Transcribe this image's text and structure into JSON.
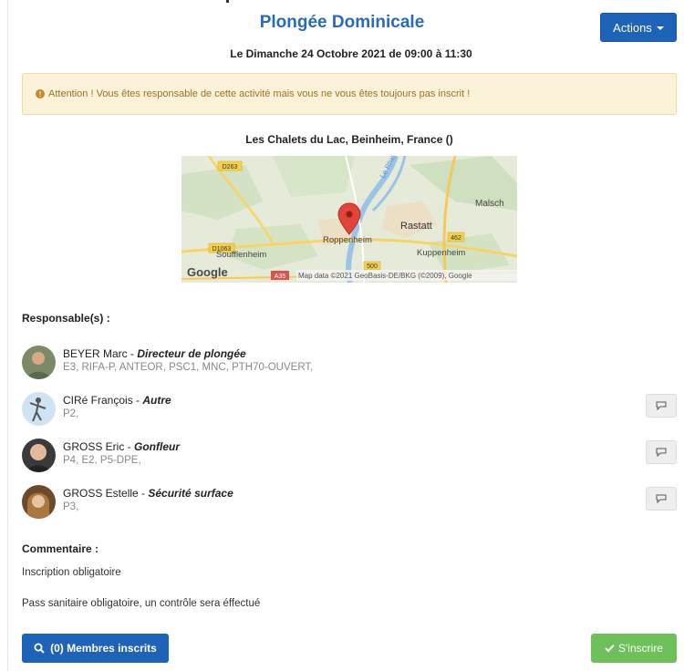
{
  "event": {
    "title": "Plongée Dominicale",
    "date": "Le Dimanche 24 Octobre 2021 de 09:00 à 11:30",
    "location": "Les Chalets du Lac, Beinheim, France ()"
  },
  "actions": {
    "label": "Actions"
  },
  "alert": {
    "text": "Attention ! Vous êtes responsable de cette activité mais vous ne vous êtes toujours pas inscrit !"
  },
  "map": {
    "labels": {
      "road1": "D263",
      "road2": "D1063",
      "road3": "462",
      "road4": "500",
      "road5": "A35",
      "river": "Le Rhin",
      "town1": "Malsch",
      "town2": "Rastatt",
      "town3": "Roppenheim",
      "town4": "Soufflenheim",
      "town5": "Kuppenheim",
      "google": "Google",
      "credit": "Map data ©2021 GeoBasis-DE/BKG (©2009), Google"
    }
  },
  "responsables": {
    "heading": "Responsable(s) :",
    "people": [
      {
        "name": "BEYER Marc",
        "role": "Directeur de plongée",
        "quals": "E3, RIFA-P, ANTEOR, PSC1, MNC, PTH70-OUVERT,"
      },
      {
        "name": "CIRé François",
        "role": "Autre",
        "quals": "P2,"
      },
      {
        "name": "GROSS Eric",
        "role": "Gonfleur",
        "quals": "P4, E2, P5-DPE,"
      },
      {
        "name": "GROSS Estelle",
        "role": "Sécurité surface",
        "quals": "P3,"
      }
    ]
  },
  "comment": {
    "heading": "Commentaire :",
    "line1": "Inscription obligatoire",
    "line2": "Pass sanitaire obligatoire, un contrôle sera éffectué"
  },
  "buttons": {
    "members": "(0) Membres inscrits",
    "register": "S'inscrire"
  },
  "colors": {
    "primary": "#1f63b8",
    "success": "#6fbf5a",
    "warning_bg": "#fcf1d9",
    "title": "#2a6bb5"
  },
  "icons": {
    "search": "search-icon",
    "check": "check-icon",
    "message": "comment-icon",
    "warning": "exclamation-circle-icon",
    "marker": "map-marker-icon"
  }
}
